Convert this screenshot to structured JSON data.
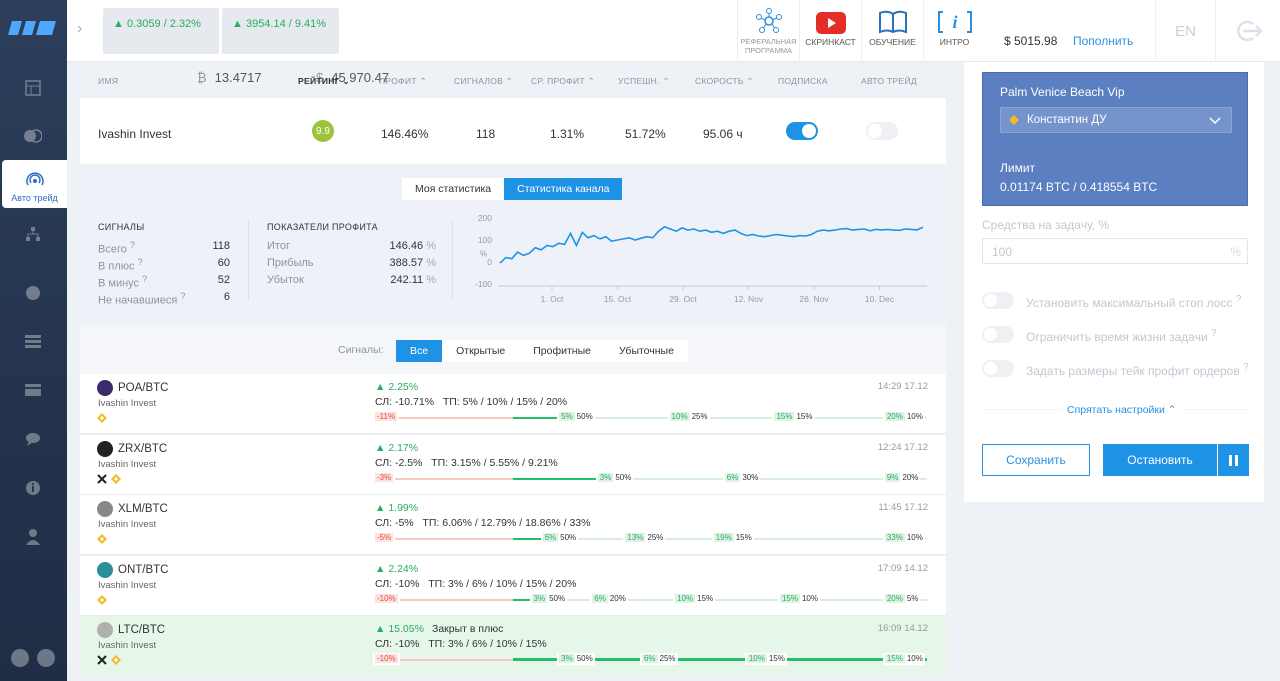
{
  "topbar": {
    "tickers": [
      {
        "symbol": "₿",
        "value": "13.4717",
        "change": "0.3059 / 2.32%"
      },
      {
        "symbol": "$",
        "value": "45 970.47",
        "change": "3954.14 / 9.41%"
      }
    ],
    "items": [
      {
        "label": "РЕФЕРАЛЬНАЯ ПРОГРАММА",
        "icon": "network-icon"
      },
      {
        "label": "СКРИНКАСТ",
        "icon": "youtube-icon"
      },
      {
        "label": "ОБУЧЕНИЕ",
        "icon": "book-icon"
      },
      {
        "label": "ИНТРО",
        "icon": "info-icon"
      }
    ],
    "balance": "$ 5015.98",
    "topup": "Пополнить",
    "lang": "EN"
  },
  "sidebar": {
    "active_label": "Авто трейд"
  },
  "table": {
    "headers": [
      "ИМЯ",
      "РЕЙТИНГ",
      "ПРОФИТ",
      "СИГНАЛОВ",
      "СР. ПРОФИТ",
      "УСПЕШН.",
      "СКОРОСТЬ",
      "ПОДПИСКА",
      "АВТО ТРЕЙД"
    ],
    "row": {
      "name": "Ivashin Invest",
      "rating": "9.9",
      "profit": "146.46%",
      "signals": "118",
      "avg_profit": "1.31%",
      "success": "51.72%",
      "speed": "95.06 ч",
      "subscription": true,
      "autotrade": false
    }
  },
  "stats": {
    "tabs": [
      "Моя статистика",
      "Статистика канала"
    ],
    "signals_title": "СИГНАЛЫ",
    "signals": [
      {
        "label": "Всего",
        "value": "118"
      },
      {
        "label": "В плюс",
        "value": "60"
      },
      {
        "label": "В минус",
        "value": "52"
      },
      {
        "label": "Не начавшиеся",
        "value": "6"
      }
    ],
    "profit_title": "ПОКАЗАТЕЛИ ПРОФИТА",
    "profit": [
      {
        "label": "Итог",
        "value": "146.46"
      },
      {
        "label": "Прибыль",
        "value": "388.57"
      },
      {
        "label": "Убыток",
        "value": "242.11"
      }
    ],
    "unit": "%"
  },
  "chart_data": {
    "type": "line",
    "ylabel": "%",
    "ylim": [
      -100,
      200
    ],
    "yticks": [
      "200",
      "100",
      "0",
      "-100"
    ],
    "xticks": [
      "1. Oct",
      "15. Oct",
      "29. Oct",
      "12. Nov",
      "26. Nov",
      "10. Dec"
    ],
    "series": [
      {
        "values": [
          -5,
          20,
          15,
          45,
          30,
          40,
          65,
          55,
          75,
          70,
          85,
          80,
          130,
          75,
          135,
          110,
          120,
          105,
          115,
          95,
          100,
          105,
          110,
          100,
          108,
          115,
          110,
          140,
          160,
          150,
          140,
          155,
          145,
          150,
          140,
          145,
          135,
          140,
          130,
          140,
          145,
          130,
          120,
          125,
          118,
          115,
          120,
          125,
          122,
          118,
          115,
          120,
          118,
          125,
          140,
          145,
          142,
          145,
          150,
          152,
          145,
          148,
          150,
          142,
          148,
          146,
          148,
          145,
          144,
          150,
          148,
          146,
          158
        ]
      }
    ]
  },
  "filters": {
    "label": "Сигналы:",
    "tabs": [
      "Все",
      "Открытые",
      "Профитные",
      "Убыточные"
    ]
  },
  "signals": [
    {
      "pair": "POA/BTC",
      "author": "Ivashin Invest",
      "change": "2.25%",
      "status": "",
      "sl": "СЛ: -10.71%",
      "tp": "ТП: 5% / 10% / 15% / 20%",
      "time": "14:29 17.12",
      "icon_color": "#3a2a6e",
      "stop": "-11%",
      "progress": 0.0,
      "targets": [
        {
          "pct": "5%",
          "amt": "50%",
          "pos": 0.38
        },
        {
          "pct": "10%",
          "amt": "25%",
          "pos": 0.58
        },
        {
          "pct": "15%",
          "amt": "15%",
          "pos": 0.77
        },
        {
          "pct": "20%",
          "amt": "10%",
          "pos": 0.97
        }
      ]
    },
    {
      "pair": "ZRX/BTC",
      "author": "Ivashin Invest",
      "change": "2.17%",
      "status": "",
      "sl": "СЛ: -2.5%",
      "tp": "ТП: 3.15% / 5.55% / 9.21%",
      "time": "12:24 17.12",
      "icon_color": "#222222",
      "stop": "-3%",
      "progress": 0.0,
      "targets": [
        {
          "pct": "3%",
          "amt": "50%",
          "pos": 0.45
        },
        {
          "pct": "6%",
          "amt": "30%",
          "pos": 0.68
        },
        {
          "pct": "9%",
          "amt": "20%",
          "pos": 0.97
        }
      ]
    },
    {
      "pair": "XLM/BTC",
      "author": "Ivashin Invest",
      "change": "1.99%",
      "status": "",
      "sl": "СЛ: -5%",
      "tp": "ТП: 6.06% / 12.79% / 18.86% / 33%",
      "time": "11:45 17.12",
      "icon_color": "#888888",
      "stop": "-5%",
      "progress": 0.0,
      "targets": [
        {
          "pct": "6%",
          "amt": "50%",
          "pos": 0.35
        },
        {
          "pct": "13%",
          "amt": "25%",
          "pos": 0.5
        },
        {
          "pct": "19%",
          "amt": "15%",
          "pos": 0.66
        },
        {
          "pct": "33%",
          "amt": "10%",
          "pos": 0.97
        }
      ]
    },
    {
      "pair": "ONT/BTC",
      "author": "Ivashin Invest",
      "change": "2.24%",
      "status": "",
      "sl": "СЛ: -10%",
      "tp": "ТП: 3% / 6% / 10% / 15% / 20%",
      "time": "17:09 14.12",
      "icon_color": "#2a8f9b",
      "stop": "-10%",
      "progress": 0.0,
      "targets": [
        {
          "pct": "3%",
          "amt": "50%",
          "pos": 0.33
        },
        {
          "pct": "6%",
          "amt": "20%",
          "pos": 0.44
        },
        {
          "pct": "10%",
          "amt": "15%",
          "pos": 0.59
        },
        {
          "pct": "15%",
          "amt": "10%",
          "pos": 0.78
        },
        {
          "pct": "20%",
          "amt": "5%",
          "pos": 0.97
        }
      ]
    },
    {
      "pair": "LTC/BTC",
      "author": "Ivashin Invest",
      "change": "15.05%",
      "status": "Закрыт в плюс",
      "sl": "СЛ: -10%",
      "tp": "ТП: 3% / 6% / 10% / 15%",
      "time": "16:09 14.12",
      "icon_color": "#b0b0b0",
      "stop": "-10%",
      "progress": 1.0,
      "targets": [
        {
          "pct": "3%",
          "amt": "50%",
          "pos": 0.38
        },
        {
          "pct": "6%",
          "amt": "25%",
          "pos": 0.53
        },
        {
          "pct": "10%",
          "amt": "15%",
          "pos": 0.72
        },
        {
          "pct": "15%",
          "amt": "10%",
          "pos": 0.97
        }
      ]
    }
  ],
  "panel": {
    "title": "Palm Venice Beach Vip",
    "account": "Константин ДУ",
    "limit_label": "Лимит",
    "limit_value": "0.01174 BTC / 0.418554 BTC",
    "funds_label": "Средства на задачу, %",
    "funds_value": "100",
    "options": [
      "Установить максимальный стоп лосс",
      "Ограничить время жизни задачи",
      "Задать размеры тейк профит ордеров"
    ],
    "hide": "Спрятать настройки",
    "save": "Сохранить",
    "stop": "Остановить"
  }
}
